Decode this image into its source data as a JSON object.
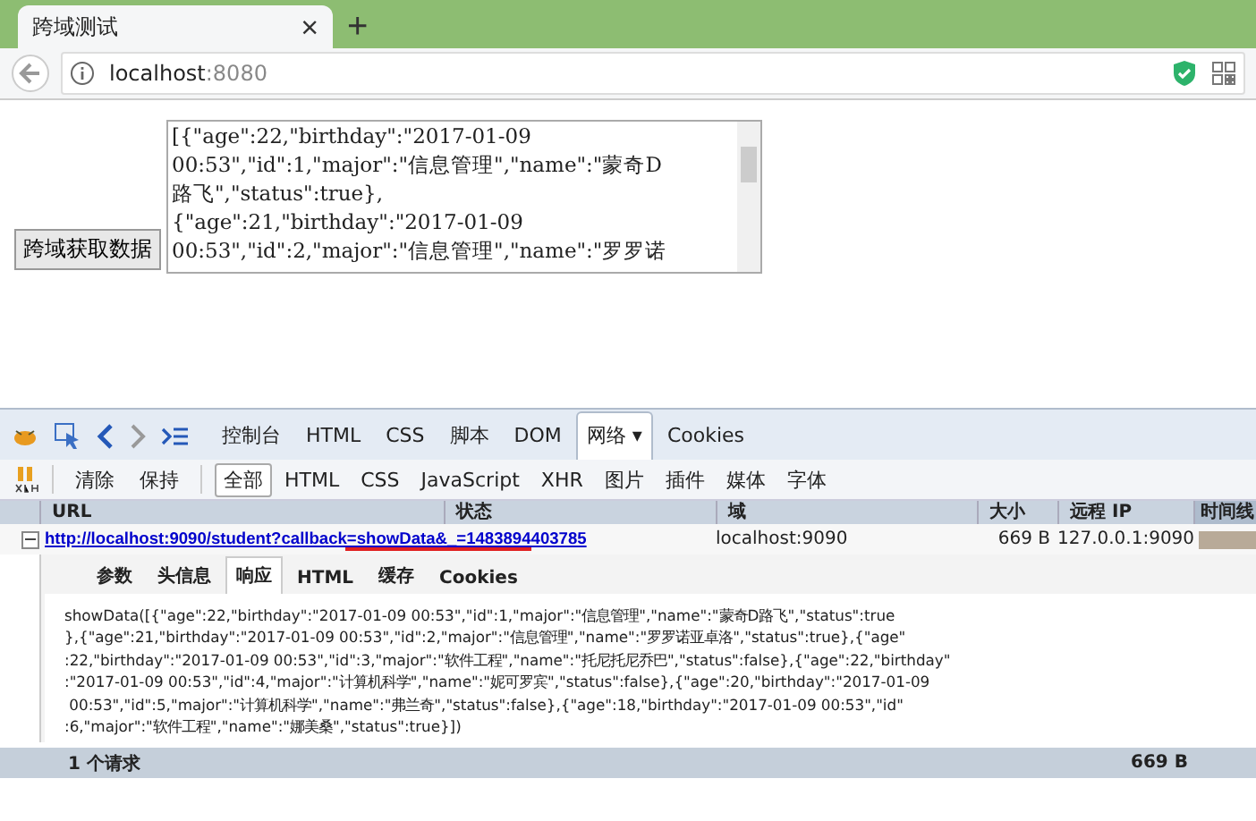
{
  "browser": {
    "tab_title": "跨域测试",
    "close": "×",
    "new_tab": "+",
    "url": "localhost:8080"
  },
  "page": {
    "button": "跨域获取数据",
    "textarea_lines": [
      "[{\"age\":22,\"birthday\":\"2017-01-09",
      "00:53\",\"id\":1,\"major\":\"信息管理\",\"name\":\"蒙奇D",
      "路飞\",\"status\":true},",
      "{\"age\":21,\"birthday\":\"2017-01-09",
      "00:53\",\"id\":2,\"major\":\"信息管理\",\"name\":\"罗罗诺"
    ]
  },
  "devtools": {
    "tabs": [
      {
        "label": "控制台",
        "selected": false
      },
      {
        "label": "HTML",
        "selected": false
      },
      {
        "label": "CSS",
        "selected": false
      },
      {
        "label": "脚本",
        "selected": false
      },
      {
        "label": "DOM",
        "selected": false
      },
      {
        "label": "网络 ▾",
        "selected": true
      },
      {
        "label": "Cookies",
        "selected": false
      }
    ],
    "actions": [
      "清除",
      "保持"
    ],
    "filters": [
      {
        "label": "全部",
        "selected": true
      },
      {
        "label": "HTML",
        "selected": false
      },
      {
        "label": "CSS",
        "selected": false
      },
      {
        "label": "JavaScript",
        "selected": false
      },
      {
        "label": "XHR",
        "selected": false
      },
      {
        "label": "图片",
        "selected": false
      },
      {
        "label": "插件",
        "selected": false
      },
      {
        "label": "媒体",
        "selected": false
      },
      {
        "label": "字体",
        "selected": false
      }
    ],
    "columns": [
      "URL",
      "状态",
      "域",
      "大小",
      "远程 IP",
      "时间线"
    ],
    "request": {
      "url": "http://localhost:9090/student?callback=showData&_=1483894403785",
      "domain": "localhost:9090",
      "size": "669 B",
      "ip": "127.0.0.1:9090",
      "expanded": true
    },
    "subtabs": [
      {
        "label": "参数",
        "selected": false
      },
      {
        "label": "头信息",
        "selected": false
      },
      {
        "label": "响应",
        "selected": true
      },
      {
        "label": "HTML",
        "selected": false
      },
      {
        "label": "缓存",
        "selected": false
      },
      {
        "label": "Cookies",
        "selected": false
      }
    ],
    "response_lines": [
      "showData([{\"age\":22,\"birthday\":\"2017-01-09 00:53\",\"id\":1,\"major\":\"信息管理\",\"name\":\"蒙奇D路飞\",\"status\":true",
      "},{\"age\":21,\"birthday\":\"2017-01-09 00:53\",\"id\":2,\"major\":\"信息管理\",\"name\":\"罗罗诺亚卓洛\",\"status\":true},{\"age\"",
      ":22,\"birthday\":\"2017-01-09 00:53\",\"id\":3,\"major\":\"软件工程\",\"name\":\"托尼托尼乔巴\",\"status\":false},{\"age\":22,\"birthday\"",
      ":\"2017-01-09 00:53\",\"id\":4,\"major\":\"计算机科学\",\"name\":\"妮可罗宾\",\"status\":false},{\"age\":20,\"birthday\":\"2017-01-09",
      " 00:53\",\"id\":5,\"major\":\"计算机科学\",\"name\":\"弗兰奇\",\"status\":false},{\"age\":18,\"birthday\":\"2017-01-09 00:53\",\"id\"",
      ":6,\"major\":\"软件工程\",\"name\":\"娜美桑\",\"status\":true}])"
    ],
    "status_bar": {
      "requests": "1 个请求",
      "total": "669 B"
    }
  }
}
